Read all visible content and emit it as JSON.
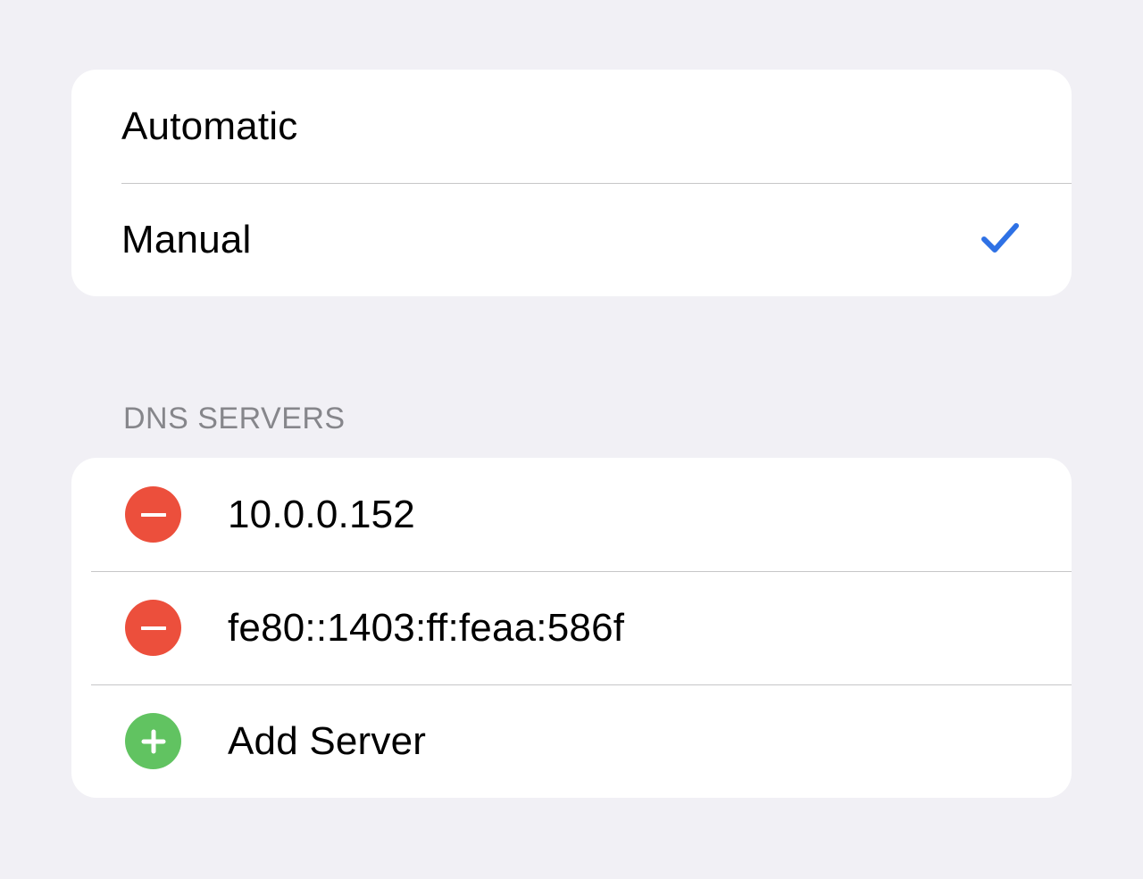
{
  "dns_mode": {
    "options": [
      {
        "label": "Automatic",
        "selected": false
      },
      {
        "label": "Manual",
        "selected": true
      }
    ]
  },
  "dns_servers": {
    "header": "DNS SERVERS",
    "entries": [
      {
        "address": "10.0.0.152"
      },
      {
        "address": "fe80::1403:ff:feaa:586f"
      }
    ],
    "add_label": "Add Server"
  }
}
